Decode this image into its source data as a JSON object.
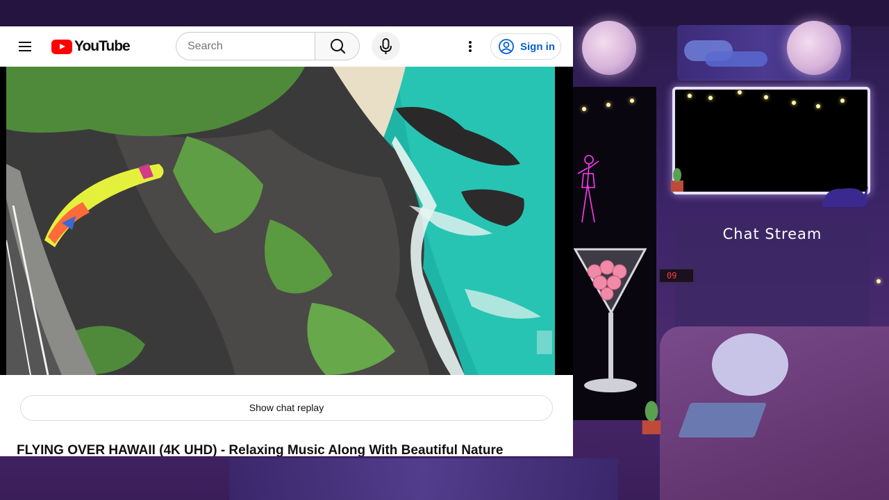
{
  "youtube": {
    "logo_text": "YouTube",
    "search": {
      "placeholder": "Search",
      "value": ""
    },
    "signin_label": "Sign in",
    "chat_replay_label": "Show chat replay",
    "video_title": "FLYING OVER HAWAII (4K UHD) - Relaxing Music Along With Beautiful Nature",
    "icons": {
      "menu": "hamburger-menu-icon",
      "search": "search-icon",
      "mic": "microphone-icon",
      "more": "more-vertical-icon",
      "account": "account-circle-icon"
    },
    "colors": {
      "brand_red": "#ff0000",
      "link_blue": "#065fd4"
    }
  },
  "overlay": {
    "chat_title": "Chat Stream",
    "clock_text": "09"
  }
}
